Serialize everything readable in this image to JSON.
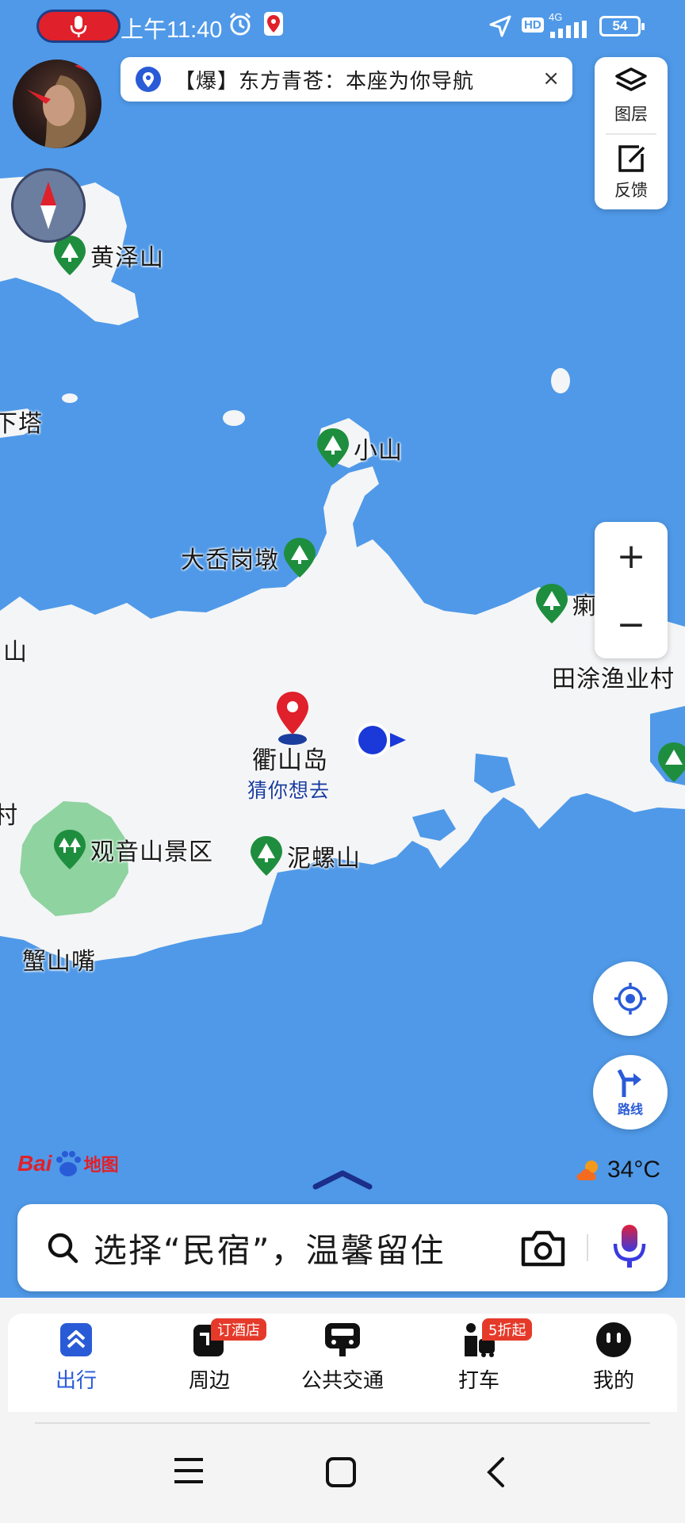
{
  "status_bar": {
    "time": "上午11:40",
    "network": "4G",
    "hd": "HD",
    "battery": "54"
  },
  "banner": {
    "text": "【爆】东方青苍：本座为你导航",
    "close": "×"
  },
  "controls": {
    "layers_label": "图层",
    "feedback_label": "反馈",
    "zoom_in": "+",
    "zoom_out": "−",
    "route_label": "路线"
  },
  "map": {
    "place_labels": [
      {
        "id": "xia-ta",
        "text": "下塔"
      },
      {
        "id": "shan-left",
        "text": "山"
      },
      {
        "id": "cun-left",
        "text": "村"
      },
      {
        "id": "tiantu",
        "text": "田涂渔业村"
      },
      {
        "id": "xieshanzui",
        "text": "蟹山嘴"
      },
      {
        "id": "qushandao",
        "text": "衢山岛"
      },
      {
        "id": "guess",
        "text": "猜你想去"
      }
    ],
    "pois": [
      {
        "id": "huangzeshan",
        "text": "黄泽山"
      },
      {
        "id": "xiaoshan",
        "text": "小山"
      },
      {
        "id": "dagangdun",
        "text": "大岙岗墩"
      },
      {
        "id": "right-edge",
        "text": "瘌"
      },
      {
        "id": "guanyin",
        "text": "观音山景区"
      },
      {
        "id": "niluoshan",
        "text": "泥螺山"
      }
    ],
    "colors": {
      "water": "#4f99e8",
      "land": "#f4f5f7",
      "park": "#8fd3a0",
      "poi": "#1e8e3e"
    }
  },
  "branding": {
    "logo_bai": "Bai",
    "logo_ditu": "地图"
  },
  "weather": {
    "temp": "34°C",
    "icon": "cloud-sun-icon"
  },
  "search": {
    "placeholder": "选择“民宿”，温馨留住"
  },
  "tabs": [
    {
      "label": "出行",
      "icon": "travel-icon",
      "active": true
    },
    {
      "label": "周边",
      "icon": "nearby-icon",
      "badge": "订酒店"
    },
    {
      "label": "公共交通",
      "icon": "bus-icon"
    },
    {
      "label": "打车",
      "icon": "taxi-icon",
      "badge": "5折起"
    },
    {
      "label": "我的",
      "icon": "profile-icon"
    }
  ],
  "accent": "#2a5bd7"
}
